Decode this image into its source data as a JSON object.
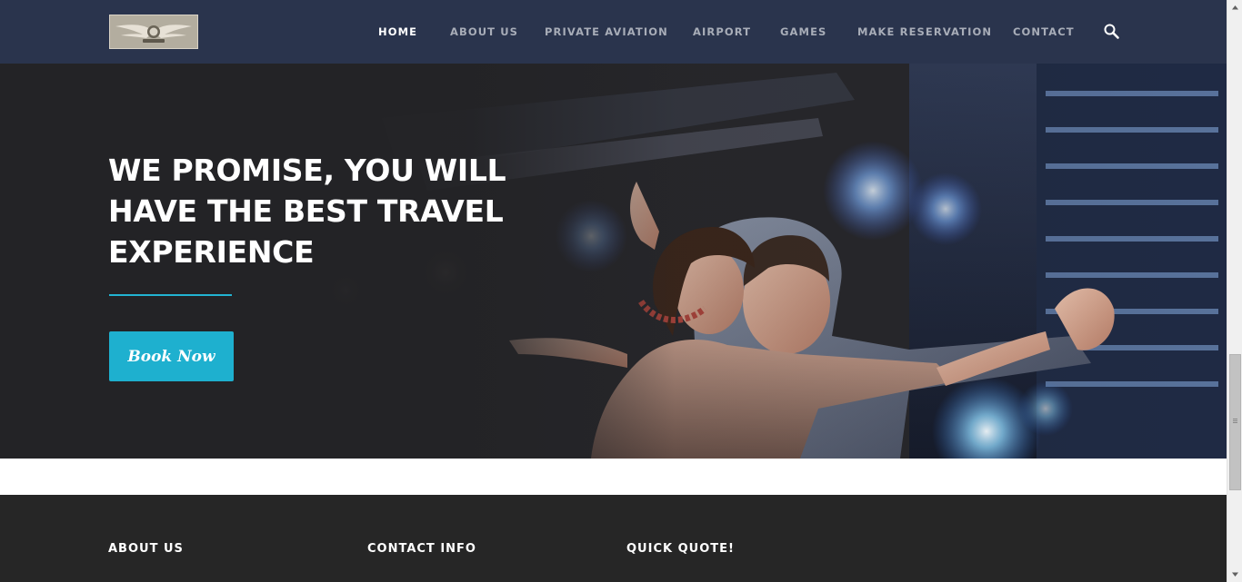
{
  "header": {
    "logo_alt": "Eagle wings logo",
    "nav": [
      {
        "label": "HOME",
        "active": true
      },
      {
        "label": "ABOUT US",
        "active": false
      },
      {
        "label": "PRIVATE AVIATION",
        "active": false
      },
      {
        "label": "AIRPORT",
        "active": false
      },
      {
        "label": "GAMES",
        "active": false
      },
      {
        "label": "MAKE RESERVATION",
        "active": false
      },
      {
        "label": "CONTACT",
        "active": false
      }
    ],
    "search_icon": "search-icon"
  },
  "hero": {
    "title_line1": "WE PROMISE, YOU WILL",
    "title_line2": "HAVE THE BEST TRAVEL",
    "title_line3": "EXPERIENCE",
    "button_label": "Book Now"
  },
  "footer": {
    "col1": "ABOUT US",
    "col2": "CONTACT INFO",
    "col3": "QUICK QUOTE!"
  },
  "colors": {
    "header_bg": "#2a344d",
    "accent": "#1eb0cf",
    "footer_bg": "#262626"
  }
}
